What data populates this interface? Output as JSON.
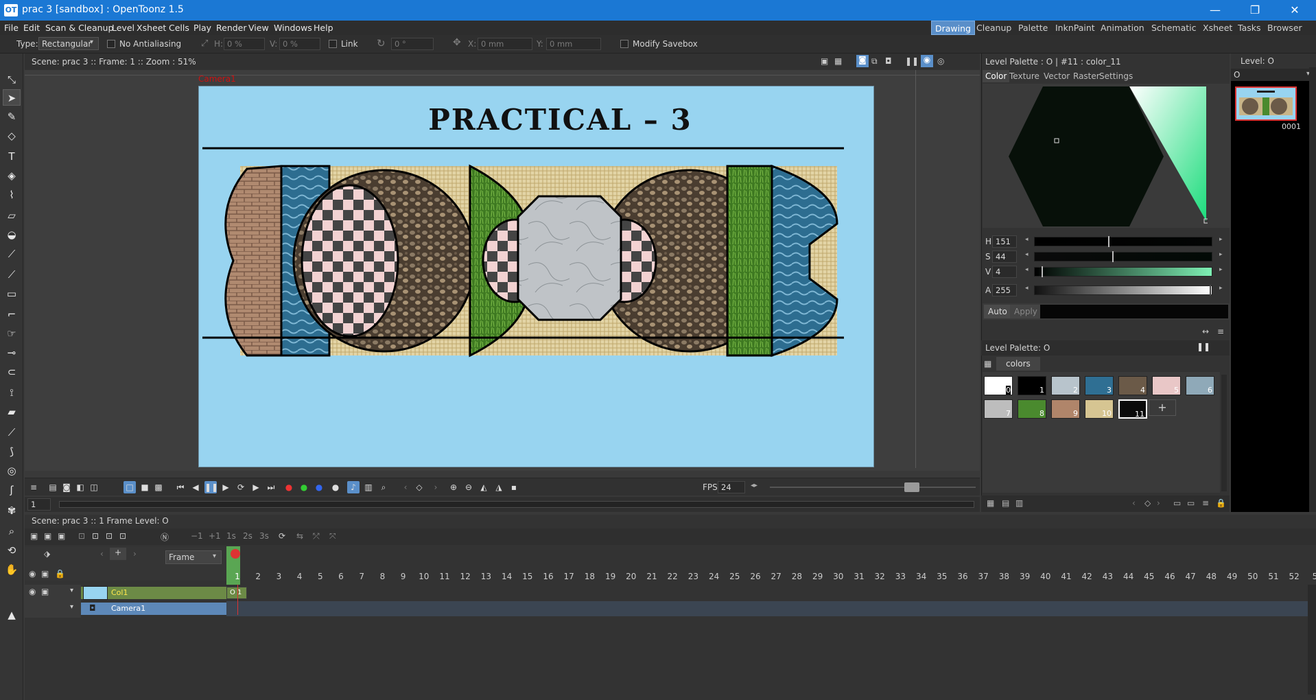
{
  "window": {
    "title": "prac 3 [sandbox] : OpenToonz 1.5",
    "logo": "OT",
    "minimize_label": "—",
    "restore_label": "❐",
    "close_label": "✕"
  },
  "menu": [
    "File",
    "Edit",
    "Scan & Cleanup",
    "Level",
    "Xsheet",
    "Cells",
    "Play",
    "Render",
    "View",
    "Windows",
    "Help"
  ],
  "rooms": {
    "items": [
      "Drawing",
      "Cleanup",
      "Palette",
      "InknPaint",
      "Animation",
      "Schematic",
      "Xsheet",
      "Tasks",
      "Browser"
    ],
    "active": "Drawing"
  },
  "tool_options": {
    "type_label": "Type:",
    "type_value": "Rectangular",
    "no_antialiasing": "No Antialiasing",
    "h_label": "H:",
    "h_value": "0 %",
    "v_label": "V:",
    "v_value": "0 %",
    "link": "Link",
    "rotation_value": "0 °",
    "x_label": "X:",
    "x_value": "0 mm",
    "y_label": "Y:",
    "y_value": "0 mm",
    "modify_savebox": "Modify Savebox"
  },
  "tools": [
    "animate-icon",
    "selection-icon",
    "brush-icon",
    "geometric-icon",
    "type-icon",
    "fill-icon",
    "paint-brush-icon",
    "eraser-icon",
    "tape-icon",
    "style-picker-icon",
    "rgb-picker-icon",
    "ruler-icon",
    "control-point-editor-icon",
    "pinch-icon",
    "pump-icon",
    "magnet-icon",
    "bender-icon",
    "iron-icon",
    "cutter-icon",
    "skeleton-icon",
    "tracker-icon",
    "hook-icon",
    "plastic-icon",
    "zoom-icon",
    "rotate-icon",
    "hand-icon"
  ],
  "viewer": {
    "header": "Scene: prac 3  ::  Frame: 1  ::  Zoom : 51%",
    "camera_label": "Camera1",
    "art_title": "PRACTICAL – 3",
    "fps_label": "FPS",
    "fps_value": "24",
    "frame_field": "1"
  },
  "style_editor": {
    "header": "Level Palette : O | #11 : color_11",
    "tabs": [
      "Color",
      "Texture",
      "Vector",
      "Raster",
      "Settings"
    ],
    "active_tab": "Color",
    "channels": [
      {
        "label": "H",
        "value": "151",
        "level": 0.42
      },
      {
        "label": "S",
        "value": "44",
        "level": 0.44
      },
      {
        "label": "V",
        "value": "4",
        "level": 0.04
      },
      {
        "label": "A",
        "value": "255",
        "level": 1.0
      }
    ],
    "auto": "Auto",
    "apply": "Apply"
  },
  "level_palette": {
    "header": "Level Palette: O",
    "page_tab": "colors",
    "styles": [
      {
        "id": "0",
        "color": "#ffffff"
      },
      {
        "id": "1",
        "color": "#000000"
      },
      {
        "id": "2",
        "color": "#b8c4cc"
      },
      {
        "id": "3",
        "color": "#2f6f93"
      },
      {
        "id": "4",
        "color": "#6b5a48"
      },
      {
        "id": "5",
        "color": "#e9c7c7"
      },
      {
        "id": "6",
        "color": "#8fa9b8"
      },
      {
        "id": "7",
        "color": "#bdbdbd"
      },
      {
        "id": "8",
        "color": "#4a8a2e"
      },
      {
        "id": "9",
        "color": "#b0856a"
      },
      {
        "id": "10",
        "color": "#d6c592"
      },
      {
        "id": "11",
        "color": "#0a0a0a"
      }
    ],
    "add_label": "+"
  },
  "level_strip": {
    "header": "Level:  O",
    "field": "O",
    "frame": "0001"
  },
  "xsheet": {
    "header": "Scene: prac 3  ::  1 Frame  Level: O",
    "frame_mode": "Frame",
    "frames": [
      "1",
      "2",
      "3",
      "4",
      "5",
      "6",
      "7",
      "8",
      "9",
      "10",
      "11",
      "12",
      "13",
      "14",
      "15",
      "16",
      "17",
      "18",
      "19",
      "20",
      "21",
      "22",
      "23",
      "24",
      "25",
      "26",
      "27",
      "28",
      "29",
      "30",
      "31",
      "32",
      "33",
      "34",
      "35",
      "36",
      "37",
      "38",
      "39",
      "40",
      "41",
      "42",
      "43",
      "44",
      "45",
      "46",
      "47",
      "48",
      "49",
      "50",
      "51",
      "52",
      "5"
    ],
    "columns": [
      {
        "name": "Col1"
      },
      {
        "name": "Camera1"
      }
    ],
    "cell": "O  1"
  }
}
